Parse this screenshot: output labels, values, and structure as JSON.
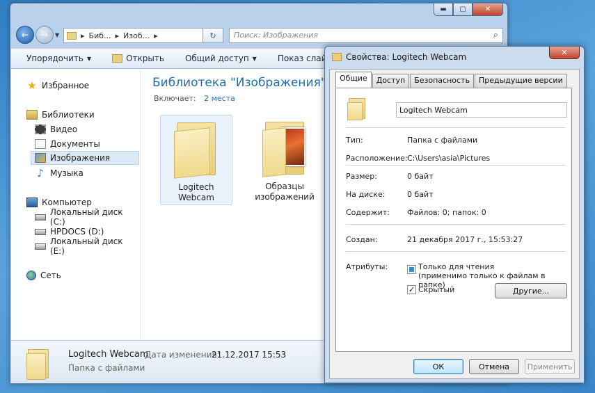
{
  "explorer": {
    "caption_buttons": [
      "▬",
      "▢",
      "✕"
    ],
    "nav": {
      "back": "←",
      "forward": "→"
    },
    "address": [
      "Биб...",
      "Изоб...",
      "▸"
    ],
    "search_placeholder": "Поиск: Изображения",
    "toolbar": [
      "Упорядочить",
      "Открыть",
      "Общий доступ",
      "Показ слайдов"
    ],
    "sidebar": {
      "favorites": "Избранное",
      "libraries": "Библиотеки",
      "lib_items": [
        "Видео",
        "Документы",
        "Изображения",
        "Музыка"
      ],
      "computer": "Компьютер",
      "drives": [
        "Локальный диск (C:)",
        "HPDOCS (D:)",
        "Локальный диск (E:)"
      ],
      "network": "Сеть"
    },
    "library_title": "Библиотека \"Изображения\"",
    "includes_label": "Включает:",
    "includes_link": "2 места",
    "tiles": [
      {
        "line1": "Logitech",
        "line2": "Webcam"
      },
      {
        "line1": "Образцы",
        "line2": "изображений"
      }
    ],
    "details": {
      "name": "Logitech Webcam",
      "date_label": "Дата изменения:",
      "date": "21.12.2017 15:53",
      "type": "Папка с файлами"
    }
  },
  "properties": {
    "title": "Свойства: Logitech Webcam",
    "close": "✕",
    "tabs": [
      "Общие",
      "Доступ",
      "Безопасность",
      "Предыдущие версии"
    ],
    "name": "Logitech Webcam",
    "rows": [
      {
        "label": "Тип:",
        "value": "Папка с файлами"
      },
      {
        "label": "Расположение:",
        "value": "C:\\Users\\asia\\Pictures"
      },
      {
        "label": "Размер:",
        "value": "0 байт"
      },
      {
        "label": "На диске:",
        "value": "0 байт"
      },
      {
        "label": "Содержит:",
        "value": "Файлов: 0; папок: 0"
      }
    ],
    "created_label": "Создан:",
    "created_value": "21 декабря 2017 г., 15:53:27",
    "attributes_label": "Атрибуты:",
    "readonly_line1": "Только для чтения",
    "readonly_line2": "(применимо только к файлам в папке)",
    "hidden_label": "Скрытый",
    "hidden_check": "✓",
    "other_button": "Другие...",
    "buttons": {
      "ok": "ОК",
      "cancel": "Отмена",
      "apply": "Применить"
    }
  }
}
